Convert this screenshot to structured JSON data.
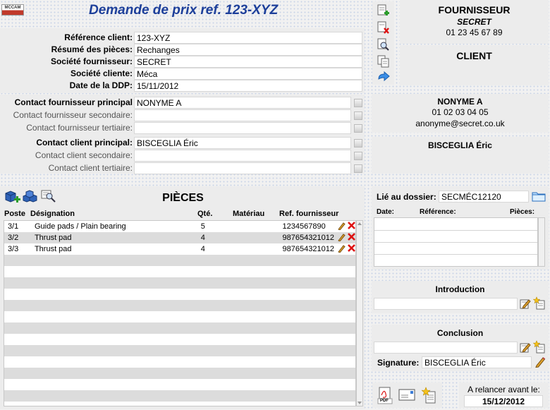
{
  "header": {
    "logo_text": "MCCAM",
    "title": "Demande de prix ref. 123-XYZ"
  },
  "form": {
    "rows": [
      {
        "label": "Référence client:",
        "value": "123-XYZ"
      },
      {
        "label": "Résumé des pièces:",
        "value": "Rechanges"
      },
      {
        "label": "Société fournisseur:",
        "value": "SECRET"
      },
      {
        "label": "Société cliente:",
        "value": "Méca"
      },
      {
        "label": "Date de la DDP:",
        "value": "15/11/2012"
      }
    ]
  },
  "contacts": {
    "rows": [
      {
        "label": "Contact fournisseur principal",
        "value": "NONYME A"
      },
      {
        "label": "Contact fournisseur secondaire:",
        "value": ""
      },
      {
        "label": "Contact fournisseur tertiaire:",
        "value": ""
      },
      {
        "label": "Contact client principal:",
        "value": "BISCEGLIA Éric"
      },
      {
        "label": "Contact client secondaire:",
        "value": ""
      },
      {
        "label": "Contact client tertiaire:",
        "value": ""
      }
    ]
  },
  "supplier": {
    "heading": "FOURNISSEUR",
    "name": "SECRET",
    "phone": "01 23 45 67 89"
  },
  "client": {
    "heading": "CLIENT"
  },
  "supplier_contact": {
    "name": "NONYME A",
    "phone": "01 02 03 04 05",
    "email": "anonyme@secret.co.uk"
  },
  "client_contact": {
    "name": "BISCEGLIA Éric"
  },
  "parts": {
    "title": "PIÈCES",
    "columns": {
      "poste": "Poste",
      "designation": "Désignation",
      "qty": "Qté.",
      "material": "Matériau",
      "ref": "Ref. fournisseur"
    },
    "rows": [
      {
        "poste": "3/1",
        "designation": "Guide pads / Plain bearing",
        "qty": "5",
        "material": "",
        "ref": "1234567890"
      },
      {
        "poste": "3/2",
        "designation": "Thrust pad",
        "qty": "4",
        "material": "",
        "ref": "987654321012"
      },
      {
        "poste": "3/3",
        "designation": "Thrust pad",
        "qty": "4",
        "material": "",
        "ref": "987654321012"
      }
    ]
  },
  "dossier": {
    "label": "Lié au dossier:",
    "value": "SECMÉC12120",
    "columns": {
      "date": "Date:",
      "reference": "Référence:",
      "pieces": "Pièces:"
    }
  },
  "introduction": {
    "label": "Introduction",
    "value": ""
  },
  "conclusion": {
    "label": "Conclusion",
    "value": ""
  },
  "signature": {
    "label": "Signature:",
    "value": "BISCEGLIA Éric"
  },
  "reminder": {
    "label": "A relancer avant le:",
    "date": "15/12/2012"
  },
  "icons": {
    "pdf_text": "PDF"
  }
}
